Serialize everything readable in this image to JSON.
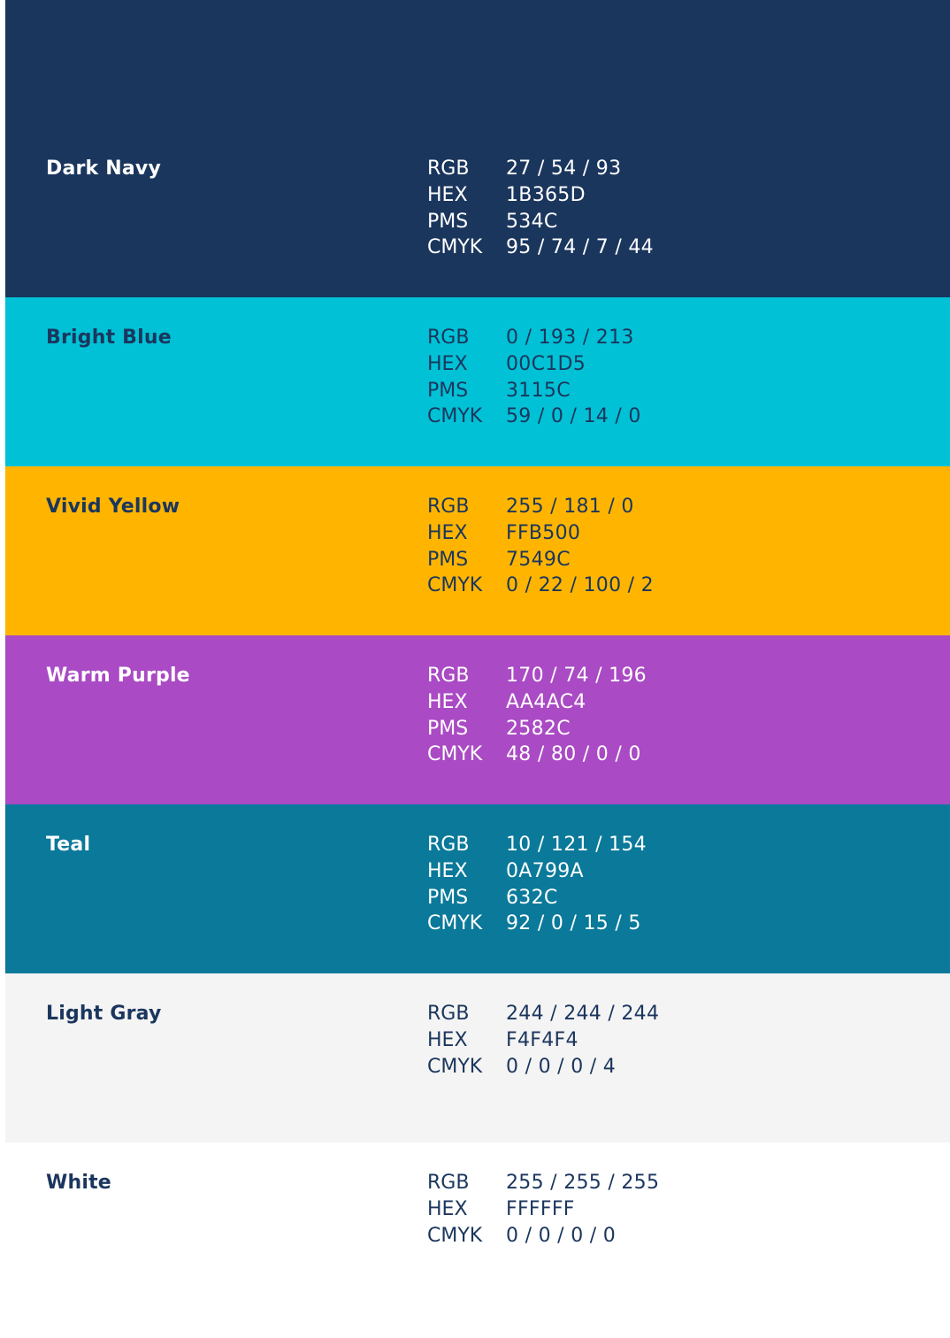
{
  "swatches": [
    {
      "name": "Dark Navy",
      "bg": "#1B365D",
      "fg": "#ffffff",
      "specs": [
        {
          "label": "RGB",
          "value": "27 / 54 / 93"
        },
        {
          "label": "HEX",
          "value": "1B365D"
        },
        {
          "label": "PMS",
          "value": "534C"
        },
        {
          "label": "CMYK",
          "value": "95 / 74 / 7 / 44"
        }
      ]
    },
    {
      "name": "Bright Blue",
      "bg": "#00C1D5",
      "fg": "#1B365D",
      "specs": [
        {
          "label": "RGB",
          "value": "0 / 193 / 213"
        },
        {
          "label": "HEX",
          "value": "00C1D5"
        },
        {
          "label": "PMS",
          "value": "3115C"
        },
        {
          "label": "CMYK",
          "value": "59 / 0 / 14 / 0"
        }
      ]
    },
    {
      "name": "Vivid Yellow",
      "bg": "#FFB500",
      "fg": "#1B365D",
      "specs": [
        {
          "label": "RGB",
          "value": "255 / 181 / 0"
        },
        {
          "label": "HEX",
          "value": "FFB500"
        },
        {
          "label": "PMS",
          "value": "7549C"
        },
        {
          "label": "CMYK",
          "value": "0 / 22 / 100 / 2"
        }
      ]
    },
    {
      "name": "Warm Purple",
      "bg": "#AA4AC4",
      "fg": "#ffffff",
      "specs": [
        {
          "label": "RGB",
          "value": "170 / 74 / 196"
        },
        {
          "label": "HEX",
          "value": "AA4AC4"
        },
        {
          "label": "PMS",
          "value": "2582C"
        },
        {
          "label": "CMYK",
          "value": "48 / 80 / 0 / 0"
        }
      ]
    },
    {
      "name": "Teal",
      "bg": "#0A799A",
      "fg": "#ffffff",
      "specs": [
        {
          "label": "RGB",
          "value": "10 / 121 / 154"
        },
        {
          "label": "HEX",
          "value": "0A799A"
        },
        {
          "label": "PMS",
          "value": "632C"
        },
        {
          "label": "CMYK",
          "value": "92 / 0 / 15 / 5"
        }
      ]
    },
    {
      "name": "Light Gray",
      "bg": "#F4F4F4",
      "fg": "#1B365D",
      "specs": [
        {
          "label": "RGB",
          "value": "244 / 244 / 244"
        },
        {
          "label": "HEX",
          "value": "F4F4F4"
        },
        {
          "label": "CMYK",
          "value": "0 / 0 / 0 / 4"
        }
      ]
    },
    {
      "name": "White",
      "bg": "#FFFFFF",
      "fg": "#1B365D",
      "specs": [
        {
          "label": "RGB",
          "value": "255 / 255 / 255"
        },
        {
          "label": "HEX",
          "value": "FFFFFF"
        },
        {
          "label": "CMYK",
          "value": "0 / 0 / 0 / 0"
        }
      ]
    }
  ]
}
